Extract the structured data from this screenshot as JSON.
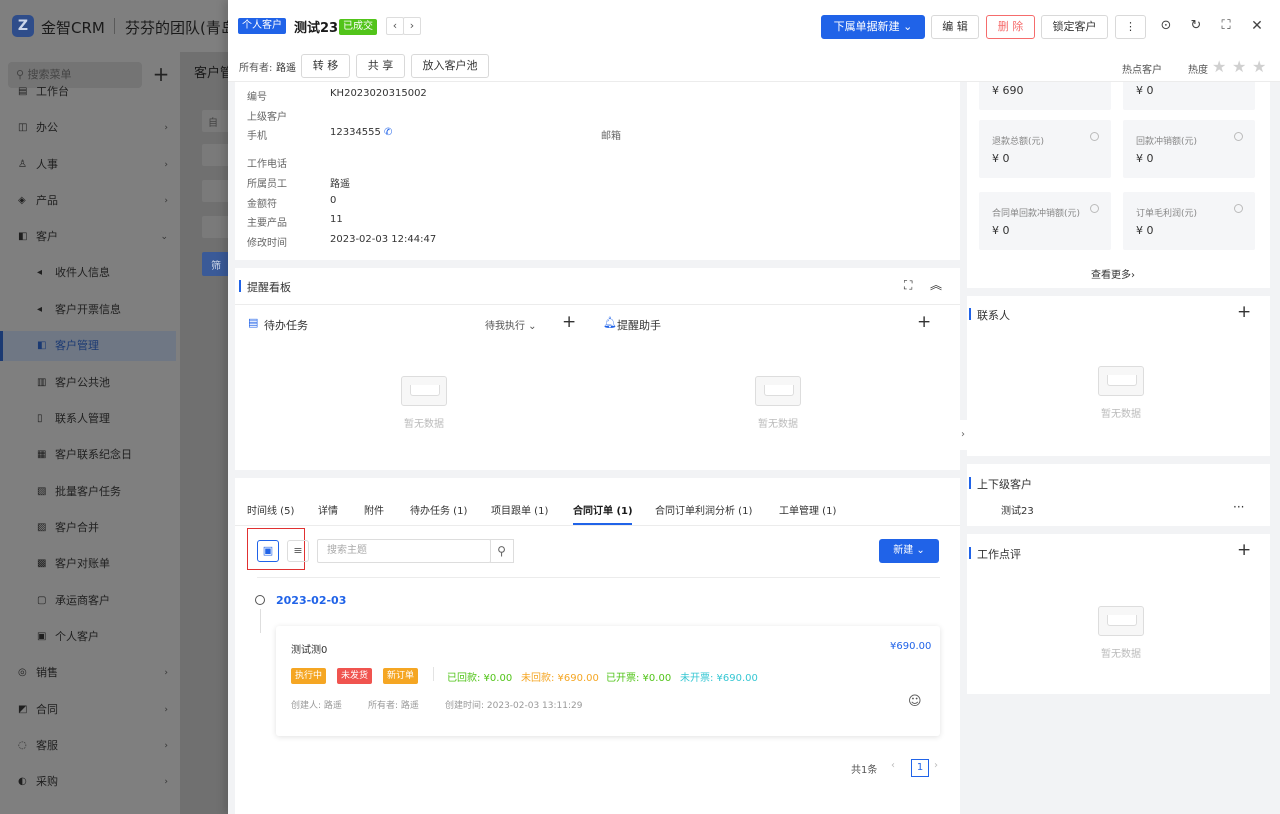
{
  "app": {
    "brand": "金智CRM",
    "logo_letter": "Z",
    "team": "芬芬的团队(青岛)"
  },
  "sidebar": {
    "search_placeholder": "⚲ 搜索菜单",
    "items": [
      {
        "icon": "▤",
        "label": "工作台",
        "arrow": ""
      },
      {
        "icon": "◫",
        "label": "办公",
        "arrow": "›"
      },
      {
        "icon": "♙",
        "label": "人事",
        "arrow": "›"
      },
      {
        "icon": "◈",
        "label": "产品",
        "arrow": "›"
      },
      {
        "icon": "◧",
        "label": "客户",
        "arrow": "⌄"
      },
      {
        "icon": "◂",
        "label": "收件人信息",
        "arrow": ""
      },
      {
        "icon": "◂",
        "label": "客户开票信息",
        "arrow": ""
      },
      {
        "icon": "◧",
        "label": "客户管理",
        "arrow": ""
      },
      {
        "icon": "▥",
        "label": "客户公共池",
        "arrow": ""
      },
      {
        "icon": "▯",
        "label": "联系人管理",
        "arrow": ""
      },
      {
        "icon": "▦",
        "label": "客户联系纪念日",
        "arrow": ""
      },
      {
        "icon": "▧",
        "label": "批量客户任务",
        "arrow": ""
      },
      {
        "icon": "▨",
        "label": "客户合并",
        "arrow": ""
      },
      {
        "icon": "▩",
        "label": "客户对账单",
        "arrow": ""
      },
      {
        "icon": "▢",
        "label": "承运商客户",
        "arrow": ""
      },
      {
        "icon": "▣",
        "label": "个人客户",
        "arrow": ""
      },
      {
        "icon": "◎",
        "label": "销售",
        "arrow": "›"
      },
      {
        "icon": "◩",
        "label": "合同",
        "arrow": "›"
      },
      {
        "icon": "◌",
        "label": "客服",
        "arrow": "›"
      },
      {
        "icon": "◐",
        "label": "采购",
        "arrow": "›"
      }
    ]
  },
  "bg": {
    "title": "客户管",
    "filter_label": "自",
    "filter_button": "筛"
  },
  "header": {
    "type_tag": "个人客户",
    "name": "测试23",
    "status_tag": "已成交",
    "prev": "‹",
    "next": "›",
    "create_sub": "下属单据新建 ⌄",
    "edit": "编 辑",
    "delete": "删 除",
    "lock": "锁定客户",
    "more": "⋮",
    "owner_label": "所有者:",
    "owner": "路遥",
    "transfer": "转 移",
    "share": "共 享",
    "to_pool": "放入客户池",
    "hot_label": "热点客户",
    "heat_label": "热度",
    "star": "★"
  },
  "info": {
    "fields": [
      {
        "label": "编号",
        "value": "KH2023020315002"
      },
      {
        "label": "上级客户",
        "value": ""
      },
      {
        "label": "手机",
        "value": "12334555"
      },
      {
        "label": "工作电话",
        "value": ""
      },
      {
        "label": "所属员工",
        "value": "路遥"
      },
      {
        "label": "金额符",
        "value": "0"
      },
      {
        "label": "主要产品",
        "value": "11"
      },
      {
        "label": "修改时间",
        "value": "2023-02-03 12:44:47"
      }
    ],
    "email_label": "邮箱",
    "phone_icon": "✆"
  },
  "remind": {
    "title": "提醒看板",
    "todo": "待办任务",
    "todo_filter": "待我执行 ⌄",
    "assistant": "提醒助手",
    "empty": "暂无数据"
  },
  "orders": {
    "tabs": [
      "时间线 (5)",
      "详情",
      "附件",
      "待办任务 (1)",
      "项目跟单 (1)",
      "合同订单 (1)",
      "合同订单利润分析 (1)",
      "工单管理 (1)"
    ],
    "search_placeholder": "搜索主题",
    "new_button": "新建 ⌄",
    "date": "2023-02-03",
    "card": {
      "title": "测试测0",
      "amount": "¥690.00",
      "tags": [
        {
          "text": "执行中",
          "color": "#f5a623"
        },
        {
          "text": "未发货",
          "color": "#f0544f"
        },
        {
          "text": "新订单",
          "color": "#f5a623"
        }
      ],
      "received": "已回款: ¥0.00",
      "unreceived": "未回款: ¥690.00",
      "invoiced": "已开票: ¥0.00",
      "uninvoiced": "未开票: ¥690.00",
      "creator": "创建人: 路遥",
      "owner": "所有者: 路遥",
      "created": "创建时间: 2023-02-03 13:11:29",
      "face_icon": "☺"
    },
    "total": "共1条",
    "page": "1",
    "prev": "‹",
    "next": "›"
  },
  "right": {
    "stats": [
      {
        "label": "",
        "value": "¥ 690"
      },
      {
        "label": "",
        "value": "¥ 0"
      },
      {
        "label": "退款总额(元)",
        "value": "¥ 0"
      },
      {
        "label": "回款冲销额(元)",
        "value": "¥ 0"
      },
      {
        "label": "合同单回款冲销额(元)",
        "value": "¥ 0"
      },
      {
        "label": "订单毛利润(元)",
        "value": "¥ 0"
      }
    ],
    "more": "查看更多›",
    "contacts": "联系人",
    "related": "上下级客户",
    "related_item": "测试23",
    "comments": "工作点评",
    "empty": "暂无数据",
    "dots": "···",
    "plus": "+"
  }
}
